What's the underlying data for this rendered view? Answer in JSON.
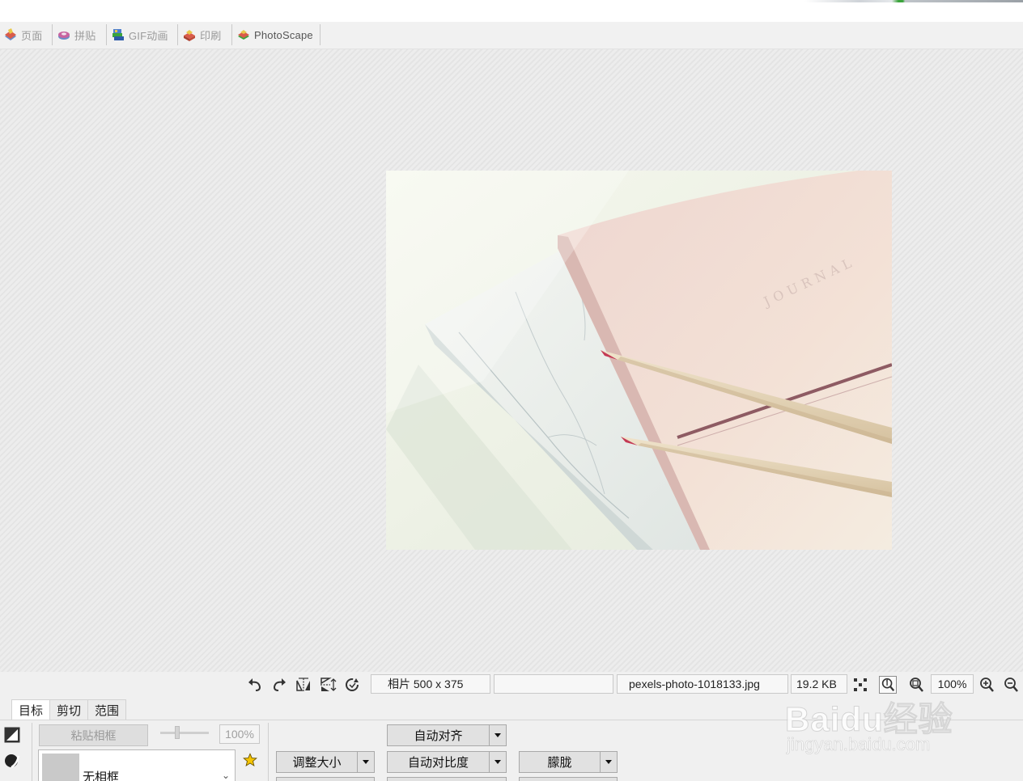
{
  "tabs": [
    {
      "label": "页面",
      "icon": "page-icon",
      "state": "disabled"
    },
    {
      "label": "拼贴",
      "icon": "combine-icon",
      "state": "disabled"
    },
    {
      "label": "GIF动画",
      "icon": "gif-animation-icon",
      "state": "disabled"
    },
    {
      "label": "印刷",
      "icon": "print-icon",
      "state": "disabled"
    },
    {
      "label": "PhotoScape",
      "icon": "photoscape-icon",
      "state": "active"
    }
  ],
  "photo": {
    "embossed_text": "JOURNAL"
  },
  "status": {
    "photo_size": "相片 500 x 375",
    "blank": "",
    "filename": "pexels-photo-1018133.jpg",
    "filesize": "19.2 KB",
    "zoom": "100%"
  },
  "status_icons": [
    "undo-icon",
    "redo-icon",
    "flip-horizontal-icon",
    "flip-vertical-icon",
    "rotate-icon",
    "fit-screen-icon",
    "zoom-actual-icon",
    "zoom-fit-icon",
    "zoom-in-icon",
    "zoom-out-icon"
  ],
  "subtabs": [
    {
      "label": "目标",
      "active": true
    },
    {
      "label": "剪切",
      "active": false
    },
    {
      "label": "范围",
      "active": false
    }
  ],
  "panel": {
    "paste_frame": "粘贴相框",
    "opacity": "100%",
    "frame_value": "无相框",
    "resize": "调整大小",
    "auto_level": "自动对齐",
    "auto_contrast": "自动对比度",
    "blur": "朦胧"
  },
  "colors": {
    "accent_green": "#3ba43b",
    "workspace_bg": "#e9e9e9",
    "toolbar_bg": "#f0f0f0"
  },
  "watermark": {
    "main": "Baidu经验",
    "sub": "jingyan.baidu.com"
  }
}
